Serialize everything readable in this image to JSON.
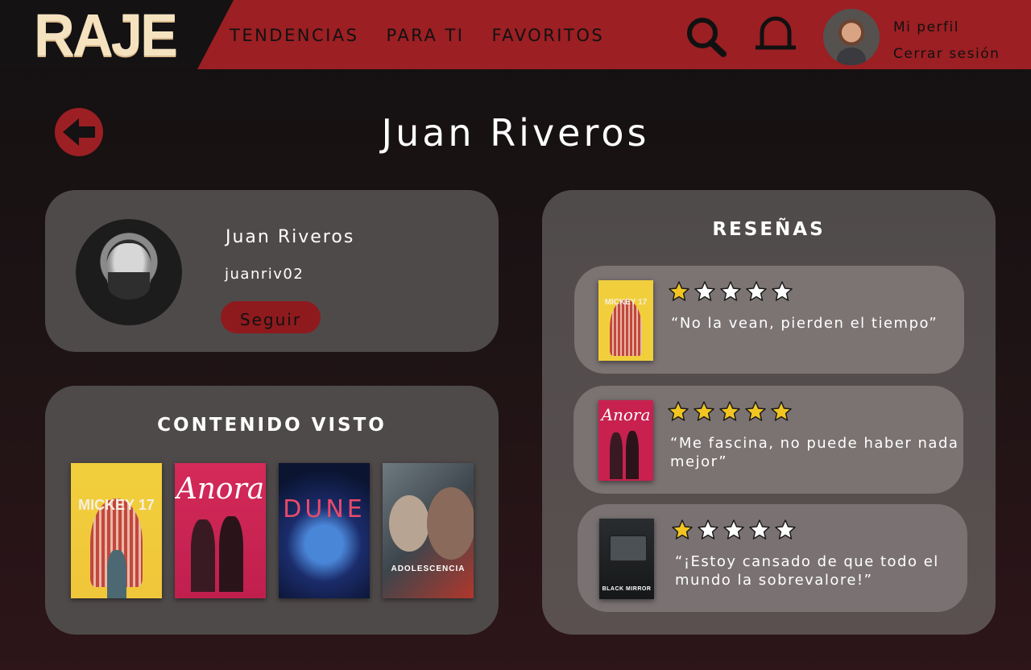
{
  "app": {
    "logo": "RAJE"
  },
  "nav": {
    "items": [
      "TENDENCIAS",
      "PARA TI",
      "FAVORITOS"
    ],
    "profile_link": "Mi perfil",
    "logout_link": "Cerrar sesión"
  },
  "page": {
    "title": "Juan Riveros"
  },
  "profile": {
    "name": "Juan Riveros",
    "handle": "juanriv02",
    "follow_label": "Seguir"
  },
  "seen": {
    "title": "CONTENIDO VISTO",
    "posters": [
      {
        "label": "MICKEY 17"
      },
      {
        "label": "Anora"
      },
      {
        "label": "DUNE"
      },
      {
        "label": "ADOLESCENCIA"
      }
    ]
  },
  "reviews": {
    "title": "RESEÑAS",
    "items": [
      {
        "poster": "MICKEY 17",
        "rating": 1,
        "text": "“No la vean, pierden el tiempo”"
      },
      {
        "poster": "Anora",
        "rating": 5,
        "text": "“Me fascina, no puede haber nada mejor”"
      },
      {
        "poster": "BLACK MIRROR",
        "rating": 1,
        "text": "“¡Estoy cansado de que todo el mundo la sobrevalore!”"
      }
    ]
  },
  "colors": {
    "brand_red": "#9b1f23",
    "star_gold": "#f2c521",
    "card": "#4f4a4a",
    "review_card": "#7b7373"
  },
  "icons": [
    "search-icon",
    "bell-icon",
    "back-arrow-icon",
    "star-icon"
  ]
}
